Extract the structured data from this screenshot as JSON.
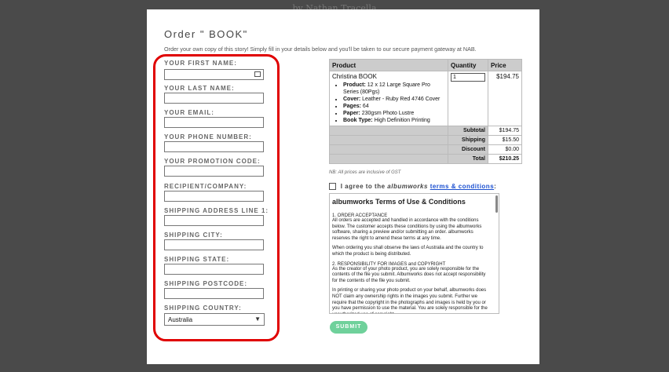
{
  "background_title": "by Nathan Tracella",
  "modal": {
    "title": "Order \" BOOK\"",
    "subtitle": "Order your own copy of this story! Simply fill in your details below and you'll be taken to our secure payment gateway at NAB."
  },
  "form": {
    "first_name_label": "YOUR FIRST NAME:",
    "last_name_label": "YOUR LAST NAME:",
    "email_label": "YOUR EMAIL:",
    "phone_label": "YOUR PHONE NUMBER:",
    "promo_label": "YOUR PROMOTION CODE:",
    "recipient_label": "RECIPIENT/COMPANY:",
    "address_label": "SHIPPING ADDRESS LINE 1:",
    "city_label": "SHIPPING CITY:",
    "state_label": "SHIPPING STATE:",
    "postcode_label": "SHIPPING POSTCODE:",
    "country_label": "SHIPPING COUNTRY:",
    "country_value": "Australia",
    "highlight_color": "#e00000"
  },
  "order": {
    "headers": [
      "Product",
      "Quantity",
      "Price"
    ],
    "product_name": "Christina BOOK",
    "details": [
      {
        "key": "Product:",
        "val": "12 x 12 Large Square Pro Series (80Pgs)"
      },
      {
        "key": "Cover:",
        "val": "Leather - Ruby Red 4746 Cover"
      },
      {
        "key": "Pages:",
        "val": "64"
      },
      {
        "key": "Paper:",
        "val": "230gsm Photo Lustre"
      },
      {
        "key": "Book Type:",
        "val": "High Definition Printing"
      }
    ],
    "quantity": "1",
    "price": "$194.75",
    "subtotal_label": "Subtotal",
    "subtotal": "$194.75",
    "shipping_label": "Shipping",
    "shipping": "$15.50",
    "discount_label": "Discount",
    "discount": "$0.00",
    "total_label": "Total",
    "total": "$210.25"
  },
  "gst_note": "NB: All prices are inclusive of GST",
  "agree": {
    "prefix": "I agree to the",
    "brand": "albumworks",
    "link": "terms & conditions",
    "suffix": ":"
  },
  "terms": {
    "title": "albumworks Terms of Use & Conditions",
    "p1_head": "1. ORDER ACCEPTANCE",
    "p1": "All orders are accepted and handled in accordance with the conditions below. The customer accepts these conditions by using the albumworks software, sharing a preview and/or submitting an order. albumworks reserves the right to amend these terms at any time.",
    "p2": "When ordering you shall observe the laws of Australia and the country to which the product is being distributed.",
    "p3_head": "2. RESPONSIBILITY FOR IMAGES and COPYRIGHT",
    "p3": "As the creator of your photo product, you are solely responsible for the contents of the file you submit. Albumworks does not accept responsibility for the contents of the file you submit.",
    "p4": "In printing or sharing your photo product on your behalf, albumworks does NOT claim any ownership rights in the images you submit. Further we require that the copyright in the photographs and images is held by you or you have permission to use the material. You are solely responsible for the unauthorized use of copyright"
  },
  "submit_label": "SUBMIT"
}
